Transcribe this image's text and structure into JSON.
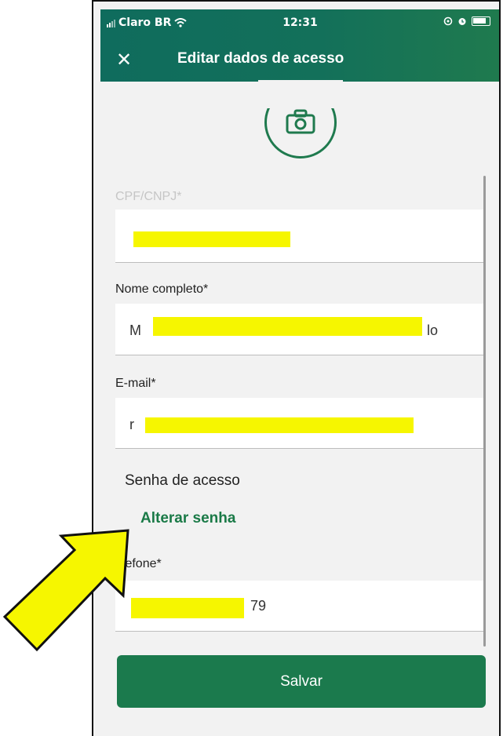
{
  "status_bar": {
    "carrier": "Claro BR",
    "time": "12:31",
    "signal_icon": "signal-bars-icon",
    "wifi_icon": "wifi-icon",
    "battery_icon": "battery-icon"
  },
  "header": {
    "title": "Editar dados de acesso",
    "close_icon": "close-icon",
    "bg_color": "#13705a"
  },
  "form": {
    "cpf_label": "CPF/CNPJ*",
    "nome_label": "Nome completo*",
    "nome_value_prefix": "M",
    "nome_value_suffix": "lo",
    "email_label": "E-mail*",
    "email_value_prefix": "r",
    "senha_label": "Senha de acesso",
    "alterar_senha": "Alterar senha",
    "telefone_label": "elefone*",
    "telefone_value_suffix": "79"
  },
  "actions": {
    "save_label": "Salvar",
    "accent_color": "#1b7a4d"
  },
  "annotation": {
    "arrow_color": "#f6f600",
    "redaction_color": "#f6f600"
  }
}
